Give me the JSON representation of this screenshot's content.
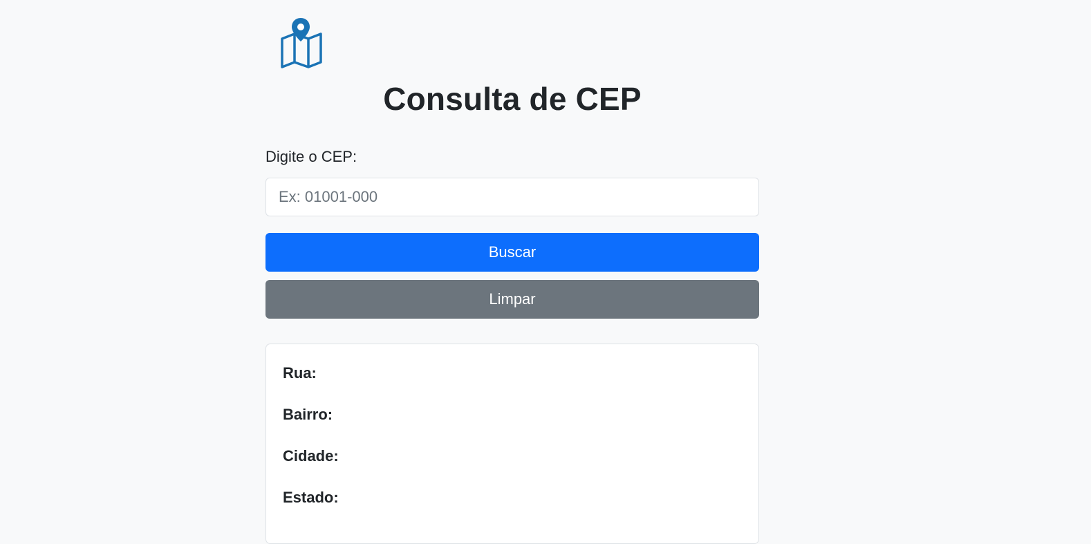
{
  "header": {
    "title": "Consulta de CEP",
    "logo_icon": "map-pin-icon",
    "accent_color": "#1a73b5"
  },
  "form": {
    "label": "Digite o CEP:",
    "input_placeholder": "Ex: 01001-000",
    "input_value": "",
    "search_button": "Buscar",
    "clear_button": "Limpar"
  },
  "result": {
    "rua_label": "Rua:",
    "rua_value": "",
    "bairro_label": "Bairro:",
    "bairro_value": "",
    "cidade_label": "Cidade:",
    "cidade_value": "",
    "estado_label": "Estado:",
    "estado_value": ""
  }
}
